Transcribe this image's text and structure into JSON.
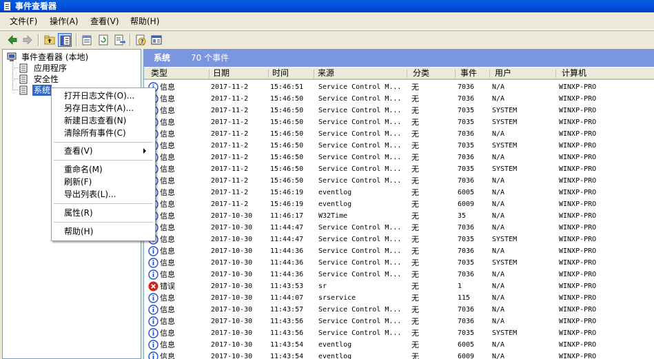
{
  "window": {
    "title": "事件查看器"
  },
  "menu": [
    {
      "label": "文件(F)"
    },
    {
      "label": "操作(A)"
    },
    {
      "label": "查看(V)"
    },
    {
      "label": "帮助(H)"
    }
  ],
  "toolbar_icons": [
    "back-arrow-icon",
    "forward-arrow-icon",
    "up-folder-icon",
    "show-tree-icon",
    "properties-icon",
    "refresh-icon",
    "export-icon",
    "help-icon",
    "console-icon"
  ],
  "tree": {
    "root": "事件查看器 (本地)",
    "items": [
      {
        "label": "应用程序"
      },
      {
        "label": "安全性"
      },
      {
        "label": "系统"
      }
    ]
  },
  "list": {
    "title": "系统",
    "count": "70 个事件",
    "columns": [
      "类型",
      "日期",
      "时间",
      "来源",
      "分类",
      "事件",
      "用户",
      "计算机"
    ],
    "rows": [
      {
        "icon": "info",
        "type": "信息",
        "date": "2017-11-2",
        "time": "15:46:51",
        "source": "Service Control M...",
        "category": "无",
        "event": "7036",
        "user": "N/A",
        "computer": "WINXP-PRO"
      },
      {
        "icon": "info",
        "type": "信息",
        "date": "2017-11-2",
        "time": "15:46:50",
        "source": "Service Control M...",
        "category": "无",
        "event": "7036",
        "user": "N/A",
        "computer": "WINXP-PRO"
      },
      {
        "icon": "info",
        "type": "信息",
        "date": "2017-11-2",
        "time": "15:46:50",
        "source": "Service Control M...",
        "category": "无",
        "event": "7035",
        "user": "SYSTEM",
        "computer": "WINXP-PRO"
      },
      {
        "icon": "info",
        "type": "信息",
        "date": "2017-11-2",
        "time": "15:46:50",
        "source": "Service Control M...",
        "category": "无",
        "event": "7035",
        "user": "SYSTEM",
        "computer": "WINXP-PRO"
      },
      {
        "icon": "info",
        "type": "信息",
        "date": "2017-11-2",
        "time": "15:46:50",
        "source": "Service Control M...",
        "category": "无",
        "event": "7036",
        "user": "N/A",
        "computer": "WINXP-PRO"
      },
      {
        "icon": "info",
        "type": "信息",
        "date": "2017-11-2",
        "time": "15:46:50",
        "source": "Service Control M...",
        "category": "无",
        "event": "7035",
        "user": "SYSTEM",
        "computer": "WINXP-PRO"
      },
      {
        "icon": "info",
        "type": "信息",
        "date": "2017-11-2",
        "time": "15:46:50",
        "source": "Service Control M...",
        "category": "无",
        "event": "7036",
        "user": "N/A",
        "computer": "WINXP-PRO"
      },
      {
        "icon": "info",
        "type": "信息",
        "date": "2017-11-2",
        "time": "15:46:50",
        "source": "Service Control M...",
        "category": "无",
        "event": "7035",
        "user": "SYSTEM",
        "computer": "WINXP-PRO"
      },
      {
        "icon": "info",
        "type": "信息",
        "date": "2017-11-2",
        "time": "15:46:50",
        "source": "Service Control M...",
        "category": "无",
        "event": "7036",
        "user": "N/A",
        "computer": "WINXP-PRO"
      },
      {
        "icon": "info",
        "type": "信息",
        "date": "2017-11-2",
        "time": "15:46:19",
        "source": "eventlog",
        "category": "无",
        "event": "6005",
        "user": "N/A",
        "computer": "WINXP-PRO"
      },
      {
        "icon": "info",
        "type": "信息",
        "date": "2017-11-2",
        "time": "15:46:19",
        "source": "eventlog",
        "category": "无",
        "event": "6009",
        "user": "N/A",
        "computer": "WINXP-PRO"
      },
      {
        "icon": "info",
        "type": "信息",
        "date": "2017-10-30",
        "time": "11:46:17",
        "source": "W32Time",
        "category": "无",
        "event": "35",
        "user": "N/A",
        "computer": "WINXP-PRO"
      },
      {
        "icon": "info",
        "type": "信息",
        "date": "2017-10-30",
        "time": "11:44:47",
        "source": "Service Control M...",
        "category": "无",
        "event": "7036",
        "user": "N/A",
        "computer": "WINXP-PRO"
      },
      {
        "icon": "info",
        "type": "信息",
        "date": "2017-10-30",
        "time": "11:44:47",
        "source": "Service Control M...",
        "category": "无",
        "event": "7035",
        "user": "SYSTEM",
        "computer": "WINXP-PRO"
      },
      {
        "icon": "info",
        "type": "信息",
        "date": "2017-10-30",
        "time": "11:44:36",
        "source": "Service Control M...",
        "category": "无",
        "event": "7036",
        "user": "N/A",
        "computer": "WINXP-PRO"
      },
      {
        "icon": "info",
        "type": "信息",
        "date": "2017-10-30",
        "time": "11:44:36",
        "source": "Service Control M...",
        "category": "无",
        "event": "7035",
        "user": "SYSTEM",
        "computer": "WINXP-PRO"
      },
      {
        "icon": "info",
        "type": "信息",
        "date": "2017-10-30",
        "time": "11:44:36",
        "source": "Service Control M...",
        "category": "无",
        "event": "7036",
        "user": "N/A",
        "computer": "WINXP-PRO"
      },
      {
        "icon": "error",
        "type": "错误",
        "date": "2017-10-30",
        "time": "11:43:53",
        "source": "sr",
        "category": "无",
        "event": "1",
        "user": "N/A",
        "computer": "WINXP-PRO"
      },
      {
        "icon": "info",
        "type": "信息",
        "date": "2017-10-30",
        "time": "11:44:07",
        "source": "srservice",
        "category": "无",
        "event": "115",
        "user": "N/A",
        "computer": "WINXP-PRO"
      },
      {
        "icon": "info",
        "type": "信息",
        "date": "2017-10-30",
        "time": "11:43:57",
        "source": "Service Control M...",
        "category": "无",
        "event": "7036",
        "user": "N/A",
        "computer": "WINXP-PRO"
      },
      {
        "icon": "info",
        "type": "信息",
        "date": "2017-10-30",
        "time": "11:43:56",
        "source": "Service Control M...",
        "category": "无",
        "event": "7036",
        "user": "N/A",
        "computer": "WINXP-PRO"
      },
      {
        "icon": "info",
        "type": "信息",
        "date": "2017-10-30",
        "time": "11:43:56",
        "source": "Service Control M...",
        "category": "无",
        "event": "7035",
        "user": "SYSTEM",
        "computer": "WINXP-PRO"
      },
      {
        "icon": "info",
        "type": "信息",
        "date": "2017-10-30",
        "time": "11:43:54",
        "source": "eventlog",
        "category": "无",
        "event": "6005",
        "user": "N/A",
        "computer": "WINXP-PRO"
      },
      {
        "icon": "info",
        "type": "信息",
        "date": "2017-10-30",
        "time": "11:43:54",
        "source": "eventlog",
        "category": "无",
        "event": "6009",
        "user": "N/A",
        "computer": "WINXP-PRO"
      }
    ]
  },
  "context_menu": {
    "items": [
      {
        "label": "打开日志文件(O)..."
      },
      {
        "label": "另存日志文件(A)..."
      },
      {
        "label": "新建日志查看(N)"
      },
      {
        "label": "清除所有事件(C)"
      },
      {
        "label": "查看(V)"
      },
      {
        "label": "重命名(M)"
      },
      {
        "label": "刷新(F)"
      },
      {
        "label": "导出列表(L)..."
      },
      {
        "label": "属性(R)"
      },
      {
        "label": "帮助(H)"
      }
    ]
  },
  "colors": {
    "titlebar": "#0054e3",
    "banner": "#7a96df",
    "selection": "#316ac5",
    "info_icon": "#1f4fcf",
    "error_icon": "#d81e1e"
  }
}
